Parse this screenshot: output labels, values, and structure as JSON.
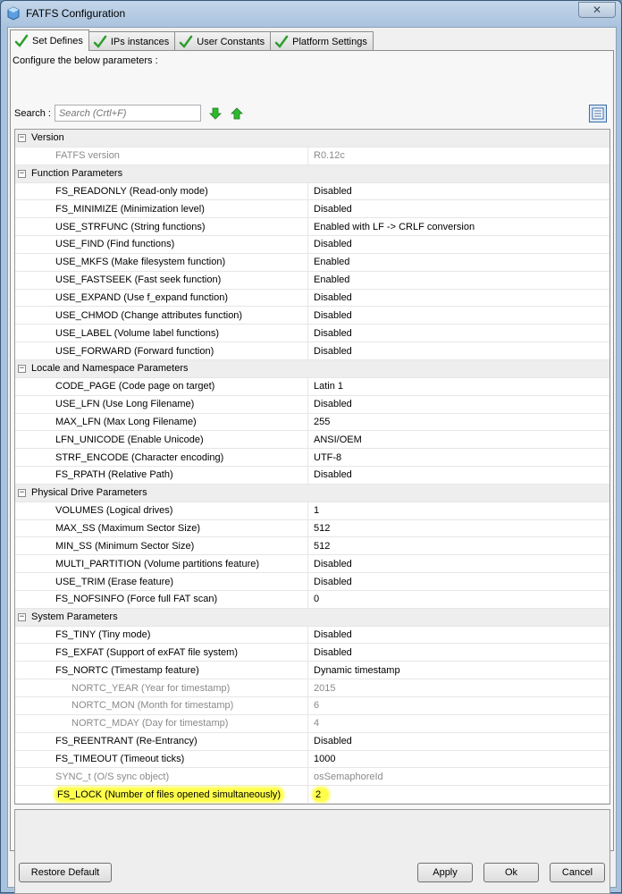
{
  "window": {
    "title": "FATFS Configuration",
    "close_glyph": "✕"
  },
  "tabs": [
    {
      "label": "Set Defines",
      "active": true
    },
    {
      "label": "IPs instances",
      "active": false
    },
    {
      "label": "User Constants",
      "active": false
    },
    {
      "label": "Platform Settings",
      "active": false
    }
  ],
  "configure_label": "Configure the below parameters :",
  "search": {
    "label": "Search :",
    "placeholder": "Search (Crtl+F)"
  },
  "groups": [
    {
      "name": "Version",
      "items": [
        {
          "name": "FATFS version",
          "value": "R0.12c",
          "readonly": true
        }
      ]
    },
    {
      "name": "Function Parameters",
      "items": [
        {
          "name": "FS_READONLY (Read-only mode)",
          "value": "Disabled"
        },
        {
          "name": "FS_MINIMIZE (Minimization level)",
          "value": "Disabled"
        },
        {
          "name": "USE_STRFUNC (String functions)",
          "value": "Enabled with LF -> CRLF conversion"
        },
        {
          "name": "USE_FIND (Find functions)",
          "value": "Disabled"
        },
        {
          "name": "USE_MKFS (Make filesystem function)",
          "value": "Enabled"
        },
        {
          "name": "USE_FASTSEEK (Fast seek function)",
          "value": "Enabled"
        },
        {
          "name": "USE_EXPAND (Use f_expand function)",
          "value": "Disabled"
        },
        {
          "name": "USE_CHMOD (Change attributes function)",
          "value": "Disabled"
        },
        {
          "name": "USE_LABEL (Volume label functions)",
          "value": "Disabled"
        },
        {
          "name": "USE_FORWARD (Forward function)",
          "value": "Disabled"
        }
      ]
    },
    {
      "name": "Locale and Namespace Parameters",
      "items": [
        {
          "name": "CODE_PAGE (Code page on target)",
          "value": "Latin 1"
        },
        {
          "name": "USE_LFN (Use Long Filename)",
          "value": "Disabled"
        },
        {
          "name": "MAX_LFN (Max Long Filename)",
          "value": "255"
        },
        {
          "name": "LFN_UNICODE (Enable Unicode)",
          "value": "ANSI/OEM"
        },
        {
          "name": "STRF_ENCODE (Character encoding)",
          "value": "UTF-8"
        },
        {
          "name": "FS_RPATH (Relative Path)",
          "value": "Disabled"
        }
      ]
    },
    {
      "name": "Physical Drive Parameters",
      "items": [
        {
          "name": "VOLUMES (Logical drives)",
          "value": "1"
        },
        {
          "name": "MAX_SS (Maximum Sector Size)",
          "value": "512"
        },
        {
          "name": "MIN_SS (Minimum Sector Size)",
          "value": "512"
        },
        {
          "name": "MULTI_PARTITION (Volume partitions feature)",
          "value": "Disabled"
        },
        {
          "name": "USE_TRIM (Erase feature)",
          "value": "Disabled"
        },
        {
          "name": "FS_NOFSINFO (Force full FAT scan)",
          "value": "0"
        }
      ]
    },
    {
      "name": "System Parameters",
      "items": [
        {
          "name": "FS_TINY (Tiny mode)",
          "value": "Disabled"
        },
        {
          "name": "FS_EXFAT (Support of exFAT file system)",
          "value": "Disabled"
        },
        {
          "name": "FS_NORTC (Timestamp feature)",
          "value": "Dynamic timestamp"
        },
        {
          "name": "NORTC_YEAR (Year for timestamp)",
          "value": "2015",
          "readonly": true,
          "sub": true
        },
        {
          "name": "NORTC_MON (Month for timestamp)",
          "value": "6",
          "readonly": true,
          "sub": true
        },
        {
          "name": "NORTC_MDAY (Day for timestamp)",
          "value": "4",
          "readonly": true,
          "sub": true
        },
        {
          "name": "FS_REENTRANT (Re-Entrancy)",
          "value": "Disabled"
        },
        {
          "name": "FS_TIMEOUT (Timeout ticks)",
          "value": "1000"
        },
        {
          "name": "SYNC_t (O/S sync object)",
          "value": "osSemaphoreId",
          "readonly": true
        },
        {
          "name": "FS_LOCK (Number of files opened simultaneously)",
          "value": "2",
          "highlight": true
        }
      ]
    }
  ],
  "buttons": {
    "restore": "Restore Default",
    "apply": "Apply",
    "ok": "Ok",
    "cancel": "Cancel"
  },
  "colors": {
    "highlight": "#ffff4a",
    "check_green": "#2e9e2e",
    "arrow_green": "#2eb82e"
  },
  "icons": {
    "app": "cube-icon",
    "tab_state": "checkmark-icon",
    "search_down": "arrow-down-icon",
    "search_up": "arrow-up-icon",
    "list_view": "list-view-icon"
  }
}
